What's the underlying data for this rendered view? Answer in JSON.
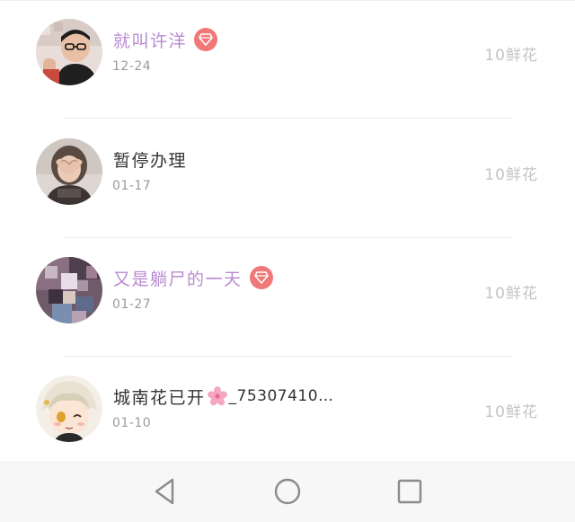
{
  "gift_list": [
    {
      "name": "就叫许洋",
      "vip": true,
      "date": "12-24",
      "amount": "10鲜花",
      "avatar": "man-with-glasses"
    },
    {
      "name": "暂停办理",
      "vip": false,
      "date": "01-17",
      "amount": "10鲜花",
      "avatar": "girl-heart-hands"
    },
    {
      "name": "又是躺尸的一天",
      "vip": true,
      "date": "01-27",
      "amount": "10鲜花",
      "avatar": "blurred-figure"
    },
    {
      "name": "城南花已开",
      "name_suffix": "_75307410…",
      "name_emoji": "cherry-blossom",
      "vip": false,
      "date": "01-10",
      "amount": "10鲜花",
      "avatar": "anime-boy"
    }
  ],
  "colors": {
    "vip_name": "#b88ad0",
    "normal_name": "#333333",
    "vip_badge": "#f07878",
    "date": "#9b9b9b",
    "amount": "#c4c4c4",
    "navbar": "#f7f7f7"
  },
  "navbar": {
    "buttons": [
      "back-icon",
      "home-icon",
      "recent-apps-icon"
    ]
  }
}
